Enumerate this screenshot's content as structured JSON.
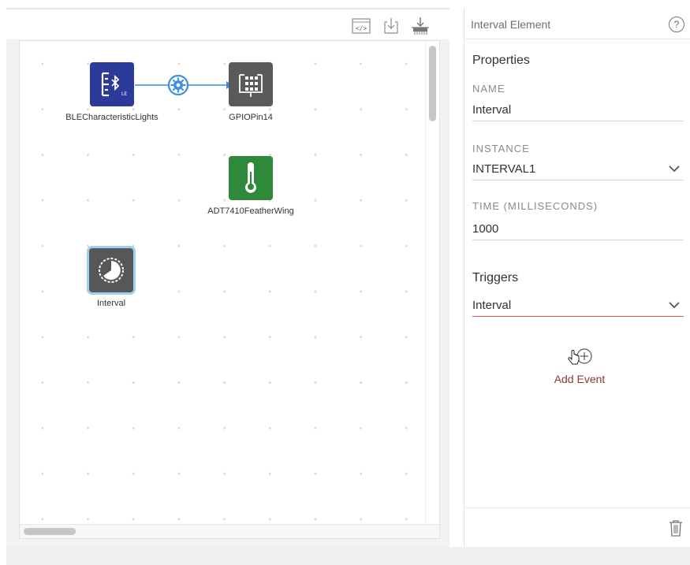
{
  "toolbar": {
    "code_icon": "code-icon",
    "download_icon": "download-icon",
    "flash_icon": "flash-device-icon"
  },
  "canvas": {
    "nodes": [
      {
        "label": "BLECharacteristicLights",
        "icon": "bluetooth-characteristic-icon",
        "color": "#2c3a9a"
      },
      {
        "label": "GPIOPin14",
        "icon": "gpio-pin-icon",
        "color": "#5a5a5a"
      },
      {
        "label": "ADT7410FeatherWing",
        "icon": "thermometer-icon",
        "color": "#2e8a3a"
      },
      {
        "label": "Interval",
        "icon": "interval-timer-icon",
        "color": "#575757",
        "selected": true
      }
    ],
    "connection": {
      "from": "BLECharacteristicLights",
      "to": "GPIOPin14",
      "icon": "gear-icon",
      "color": "#3a8ee0"
    }
  },
  "panel": {
    "title": "Interval Element",
    "help_symbol": "?",
    "properties_heading": "Properties",
    "name_label": "NAME",
    "name_value": "Interval",
    "instance_label": "INSTANCE",
    "instance_value": "INTERVAL1",
    "time_label": "TIME (MILLISECONDS)",
    "time_value": "1000",
    "triggers_heading": "Triggers",
    "trigger_value": "Interval",
    "add_event_label": "Add Event"
  }
}
